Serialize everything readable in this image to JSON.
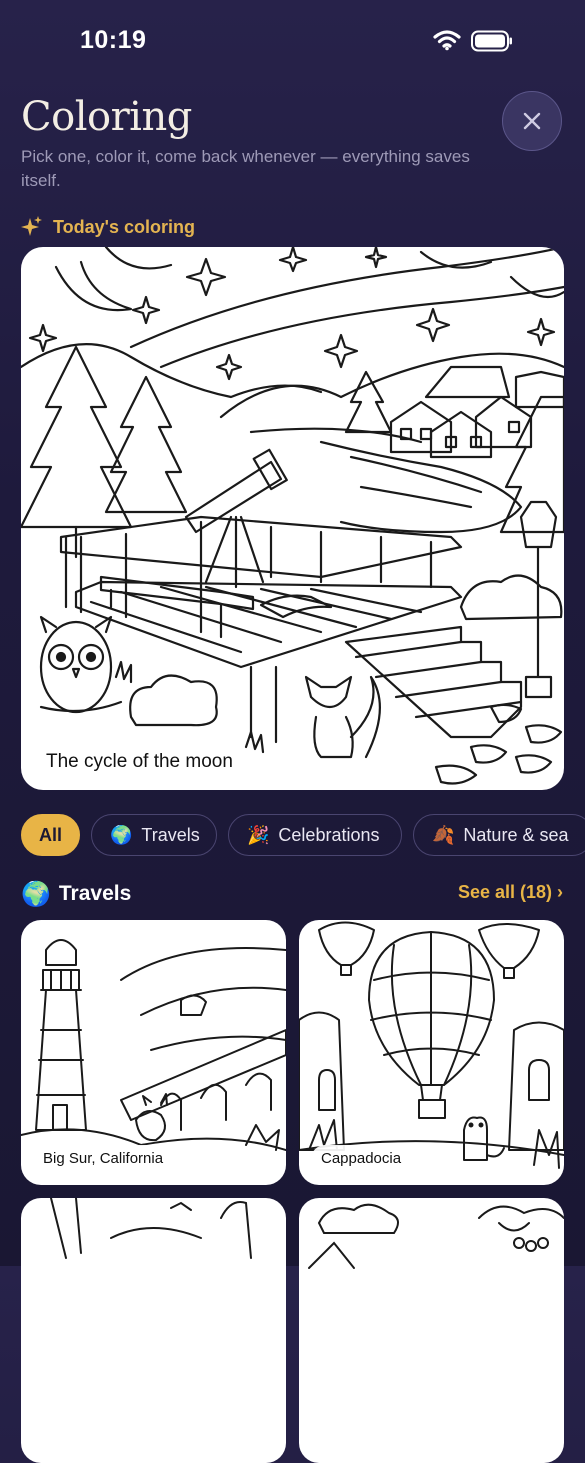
{
  "status_bar": {
    "time": "10:19"
  },
  "header": {
    "title": "Coloring",
    "subtitle": "Pick one, color it, come back whenever — everything saves itself."
  },
  "today": {
    "label": "Today's coloring",
    "caption": "The cycle of the moon"
  },
  "filters": [
    {
      "label": "All",
      "emoji": "",
      "active": true
    },
    {
      "label": "Travels",
      "emoji": "🌍",
      "active": false
    },
    {
      "label": "Celebrations",
      "emoji": "🎉",
      "active": false
    },
    {
      "label": "Nature & sea",
      "emoji": "🍂",
      "active": false
    }
  ],
  "section": {
    "emoji": "🌍",
    "title": "Travels",
    "see_all": "See all (18) ›"
  },
  "tiles": [
    {
      "label": "Big Sur, California"
    },
    {
      "label": "Cappadocia"
    },
    {
      "label": ""
    },
    {
      "label": ""
    }
  ],
  "colors": {
    "accent": "#e8b446",
    "background": "#1e1a3c",
    "today_label": "#e4b451"
  },
  "icons": {
    "close": "close-icon",
    "sparkle": "sparkle-icon",
    "wifi": "wifi-icon",
    "battery": "battery-icon"
  }
}
